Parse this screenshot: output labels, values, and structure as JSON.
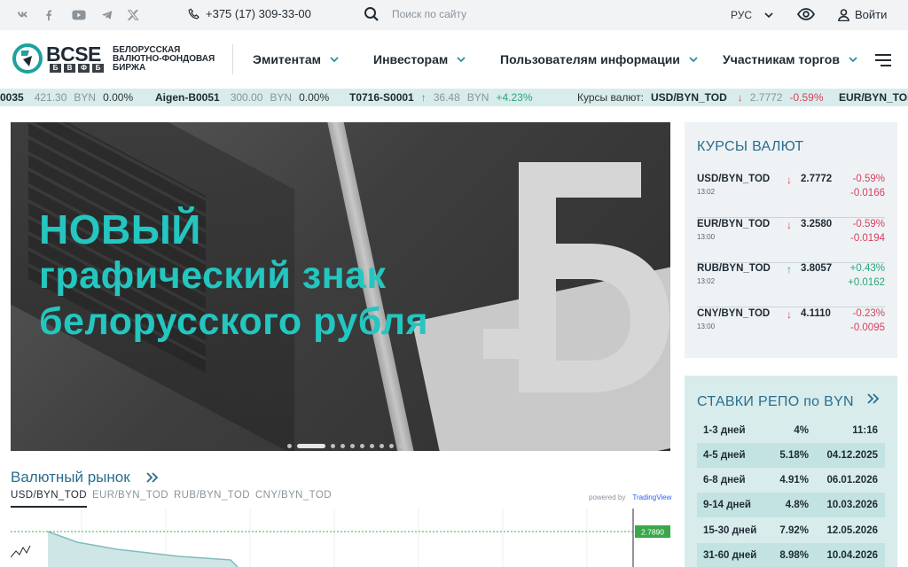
{
  "topbar": {
    "social": [
      "vk-icon",
      "facebook-icon",
      "youtube-icon",
      "telegram-icon",
      "x-icon"
    ],
    "phone": "+375 (17) 309-33-00",
    "search_placeholder": "Поиск по сайту",
    "language": "РУС",
    "login": "Войти"
  },
  "header": {
    "logo_abbr": "BCSE",
    "logo_letters": [
      "Б",
      "В",
      "Ф",
      "Б"
    ],
    "logo_line1": "БЕЛОРУССКАЯ",
    "logo_line2": "ВАЛЮТНО-ФОНДОВАЯ",
    "logo_line3": "БИРЖА",
    "nav": [
      "Эмитентам",
      "Инвесторам",
      "Пользователям информации",
      "Участникам торгов"
    ]
  },
  "ticker": {
    "items": [
      {
        "code": "0035",
        "value": "421.30",
        "cur": "BYN",
        "change": "0.00%"
      },
      {
        "code": "Aigen-B0051",
        "value": "300.00",
        "cur": "BYN",
        "change": "0.00%"
      },
      {
        "code": "T0716-S0001",
        "value": "36.48",
        "cur": "BYN",
        "change": "+4.23%"
      }
    ],
    "fx_label": "Курсы валют:",
    "fx": [
      {
        "pair": "USD/BYN_TOD",
        "value": "2.7772",
        "change": "-0.59%"
      },
      {
        "pair": "EUR/BYN_TOD"
      }
    ]
  },
  "banner": {
    "line1": "НОВЫЙ",
    "line2": "графический знак",
    "line3": "белорусского рубля",
    "slides_total": 10,
    "slide_active": 2
  },
  "market": {
    "title": "Валютный рынок",
    "tabs": [
      "USD/BYN_TOD",
      "EUR/BYN_TOD",
      "RUB/BYN_TOD",
      "CNY/BYN_TOD"
    ],
    "active_tab": 0,
    "powered_by": "powered by",
    "provider": "TradingView",
    "last_price": "2.7890"
  },
  "rates": {
    "title": "КУРСЫ ВАЛЮТ",
    "items": [
      {
        "pair": "USD/BYN_TOD",
        "time": "13:02",
        "dir": "down",
        "value": "2.7772",
        "pct": "-0.59%",
        "change": "-0.0166"
      },
      {
        "pair": "EUR/BYN_TOD",
        "time": "13:00",
        "dir": "down",
        "value": "3.2580",
        "pct": "-0.59%",
        "change": "-0.0194"
      },
      {
        "pair": "RUB/BYN_TOD",
        "time": "13:02",
        "dir": "up",
        "value": "3.8057",
        "pct": "+0.43%",
        "change": "+0.0162"
      },
      {
        "pair": "CNY/BYN_TOD",
        "time": "13:00",
        "dir": "down",
        "value": "4.1110",
        "pct": "-0.23%",
        "change": "-0.0095"
      }
    ]
  },
  "repo": {
    "title": "СТАВКИ РЕПО по BYN",
    "rows": [
      {
        "term": "1-3 дней",
        "rate": "4%",
        "date": "11:16"
      },
      {
        "term": "4-5 дней",
        "rate": "5.18%",
        "date": "04.12.2025"
      },
      {
        "term": "6-8 дней",
        "rate": "4.91%",
        "date": "06.01.2026"
      },
      {
        "term": "9-14 дней",
        "rate": "4.8%",
        "date": "10.03.2026"
      },
      {
        "term": "15-30 дней",
        "rate": "7.92%",
        "date": "12.05.2026"
      },
      {
        "term": "31-60 дней",
        "rate": "8.98%",
        "date": "10.04.2026"
      }
    ]
  },
  "colors": {
    "accent": "#2a6d8f",
    "teal": "#24c6c0",
    "positive": "#2aa57a",
    "negative": "#d9405e"
  }
}
